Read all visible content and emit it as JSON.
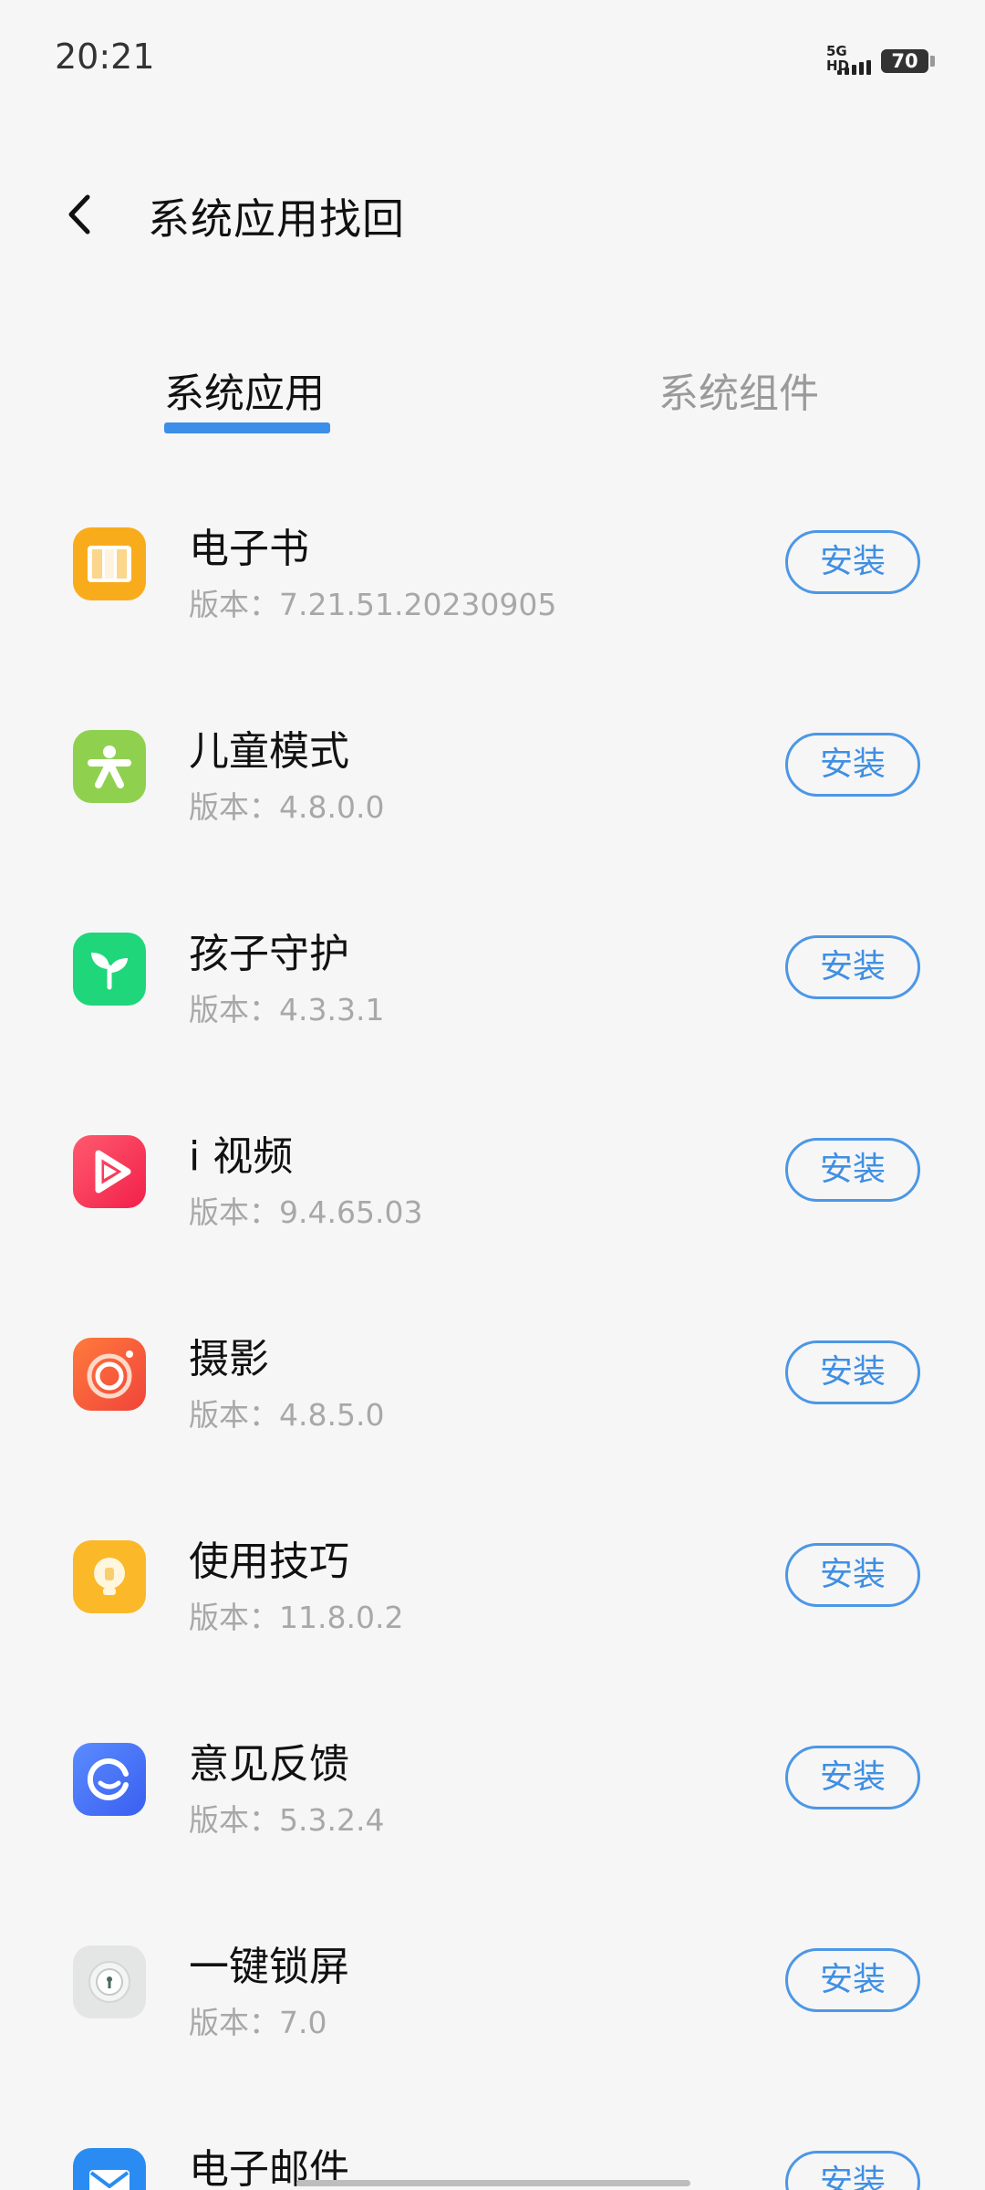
{
  "status_bar": {
    "time": "20:21",
    "network": "5G HD",
    "battery": "70"
  },
  "header": {
    "title": "系统应用找回"
  },
  "tabs": [
    {
      "label": "系统应用",
      "selected": true
    },
    {
      "label": "系统组件",
      "selected": false
    }
  ],
  "install_label": "安装",
  "apps": [
    {
      "name": "电子书",
      "version": "版本：7.21.51.20230905",
      "icon": "ebook-icon"
    },
    {
      "name": "儿童模式",
      "version": "版本：4.8.0.0",
      "icon": "kids-mode-icon"
    },
    {
      "name": "孩子守护",
      "version": "版本：4.3.3.1",
      "icon": "child-guard-icon"
    },
    {
      "name": "i 视频",
      "version": "版本：9.4.65.03",
      "icon": "video-icon"
    },
    {
      "name": "摄影",
      "version": "版本：4.8.5.0",
      "icon": "camera-icon"
    },
    {
      "name": "使用技巧",
      "version": "版本：11.8.0.2",
      "icon": "tips-icon"
    },
    {
      "name": "意见反馈",
      "version": "版本：5.3.2.4",
      "icon": "feedback-icon"
    },
    {
      "name": "一键锁屏",
      "version": "版本：7.0",
      "icon": "lock-screen-icon"
    },
    {
      "name": "电子邮件",
      "version": "",
      "icon": "email-icon"
    }
  ],
  "colors": {
    "accent": "#3d8ee8",
    "background": "#f6f6f6"
  }
}
